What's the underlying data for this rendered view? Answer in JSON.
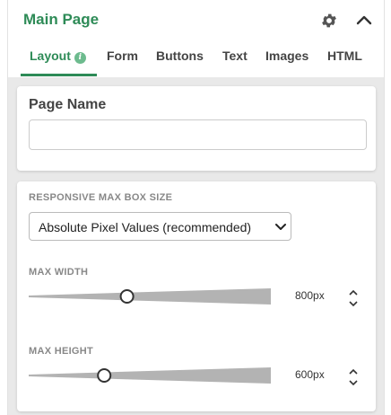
{
  "header": {
    "title": "Main Page",
    "settings_icon": "gear-icon",
    "collapse_icon": "chevron-up-icon"
  },
  "tabs": [
    {
      "label": "Layout",
      "active": true,
      "badge": "i"
    },
    {
      "label": "Form"
    },
    {
      "label": "Buttons"
    },
    {
      "label": "Text"
    },
    {
      "label": "Images"
    },
    {
      "label": "HTML"
    }
  ],
  "page_name": {
    "label": "Page Name",
    "value": "",
    "placeholder": ""
  },
  "responsive": {
    "label": "RESPONSIVE MAX BOX SIZE",
    "selected": "Absolute Pixel Values (recommended)"
  },
  "max_width": {
    "label": "MAX WIDTH",
    "value_text": "800px",
    "level": 0.4
  },
  "max_height": {
    "label": "MAX HEIGHT",
    "value_text": "600px",
    "level": 0.3
  },
  "colors": {
    "accent": "#2e8b57",
    "track": "#b3b3b3",
    "background": "#e9e9e9"
  }
}
